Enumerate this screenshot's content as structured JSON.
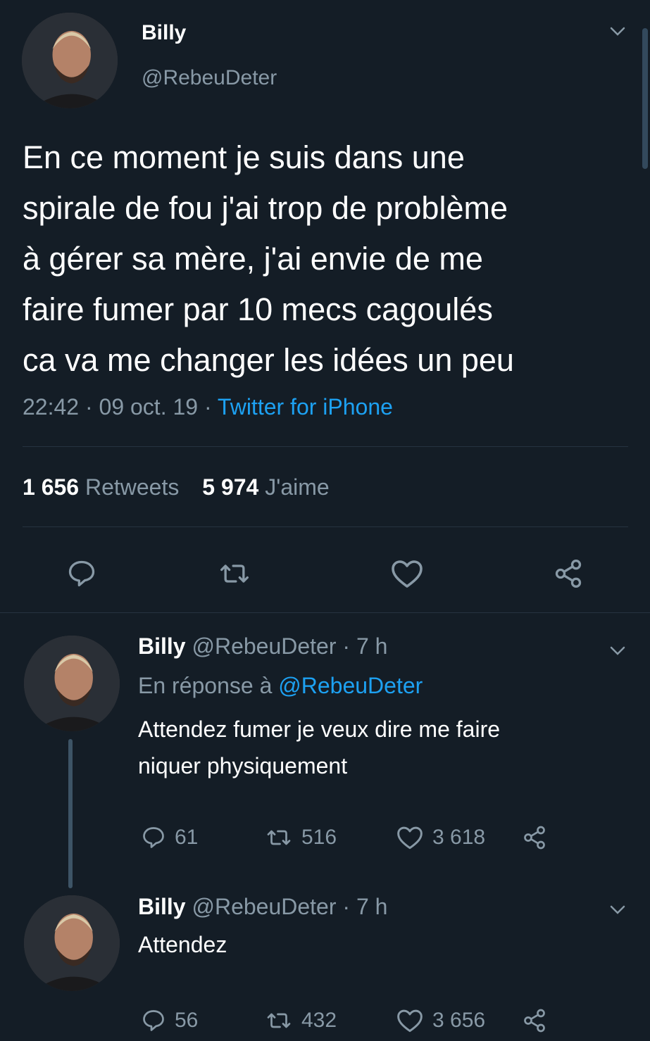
{
  "main_tweet": {
    "name": "Billy",
    "handle": "@RebeuDeter",
    "text_lines": [
      "En ce moment je suis dans une",
      "spirale de fou j'ai trop de problème",
      "à gérer sa mère, j'ai envie de me",
      "faire fumer par 10 mecs cagoulés",
      "ca va me changer les idées un peu"
    ],
    "time": "22:42 · 09 oct. 19 ·",
    "source": "Twitter for iPhone",
    "retweets_count": "1 656",
    "retweets_label": "Retweets",
    "likes_count": "5 974",
    "likes_label": "J'aime",
    "icons": [
      "reply-icon",
      "retweet-icon",
      "like-icon",
      "share-icon"
    ]
  },
  "reply1": {
    "name": "Billy",
    "handle_time": "@RebeuDeter · 7 h",
    "reply_to_label": "En réponse à",
    "reply_to_handle": "@RebeuDeter",
    "text_lines": [
      "Attendez fumer je veux dire me faire",
      "niquer physiquement"
    ],
    "replies": "61",
    "retweets": "516",
    "likes": "3 618"
  },
  "reply2": {
    "name": "Billy",
    "handle_time": "@RebeuDeter · 7 h",
    "text_lines": [
      "Attendez"
    ],
    "replies": "56",
    "retweets": "432",
    "likes": "3 656"
  },
  "colors": {
    "background": "#141d26",
    "muted": "#8899a6",
    "link": "#1da1f2",
    "divider": "#263340"
  }
}
